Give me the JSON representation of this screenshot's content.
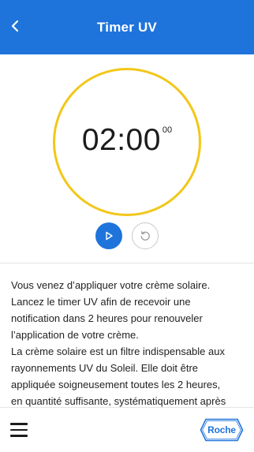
{
  "header": {
    "title": "Timer UV",
    "back_icon": "chevron-left-icon",
    "background": "#1f74db"
  },
  "timer": {
    "time": "02:00",
    "seconds": "00",
    "ring_color": "#f2c719",
    "play_icon": "play-icon",
    "reset_icon": "reset-icon"
  },
  "description": {
    "lines": [
      "Vous venez d’appliquer votre crème solaire.",
      "Lancez le timer UV afin de recevoir une",
      "notification dans 2 heures pour renouveler",
      "l’application de votre crème.",
      "La crème solaire est un filtre indispensable aux",
      "rayonnements UV du Soleil. Elle doit être",
      "appliquée soigneusement toutes les 2 heures,",
      "en quantité suffisante, systématiquement après"
    ]
  },
  "bottom_bar": {
    "menu_icon": "hamburger-menu-icon",
    "logo_text": "Roche",
    "accent": "#1f74db"
  }
}
